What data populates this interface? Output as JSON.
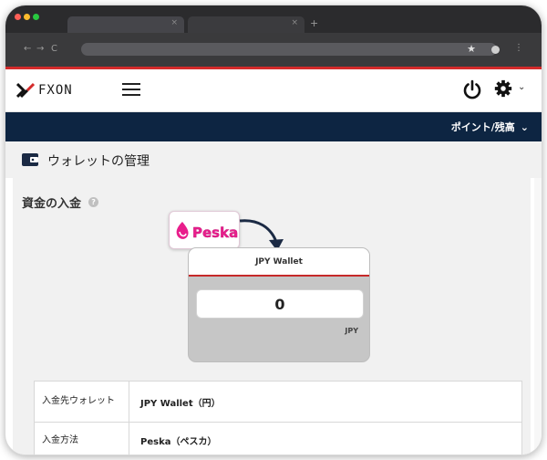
{
  "browser": {
    "tabs": [
      {
        "label": "",
        "close": "×"
      },
      {
        "label": "",
        "close": "×"
      }
    ],
    "new_tab": "+",
    "nav": {
      "back": "←",
      "forward": "→",
      "reload": "C"
    },
    "star": "★",
    "menu": "⋮"
  },
  "header": {
    "logo_text": "FXON",
    "gear_caret": "⌄"
  },
  "pointbar": {
    "label": "ポイント/残高",
    "caret": "⌄"
  },
  "page": {
    "title": "ウォレットの管理"
  },
  "deposit": {
    "section_title": "資金の入金",
    "help": "?",
    "provider_logo_text": "Peska",
    "wallet_name": "JPY Wallet",
    "amount": "0",
    "currency": "JPY"
  },
  "info_table": [
    {
      "label": "入金先ウォレット",
      "value": "JPY Wallet（円）"
    },
    {
      "label": "入金方法",
      "value": "Peska（ペスカ）"
    }
  ],
  "colors": {
    "brand_red": "#d42b2b",
    "navy": "#0d2542",
    "peska_pink": "#e91e8c"
  }
}
